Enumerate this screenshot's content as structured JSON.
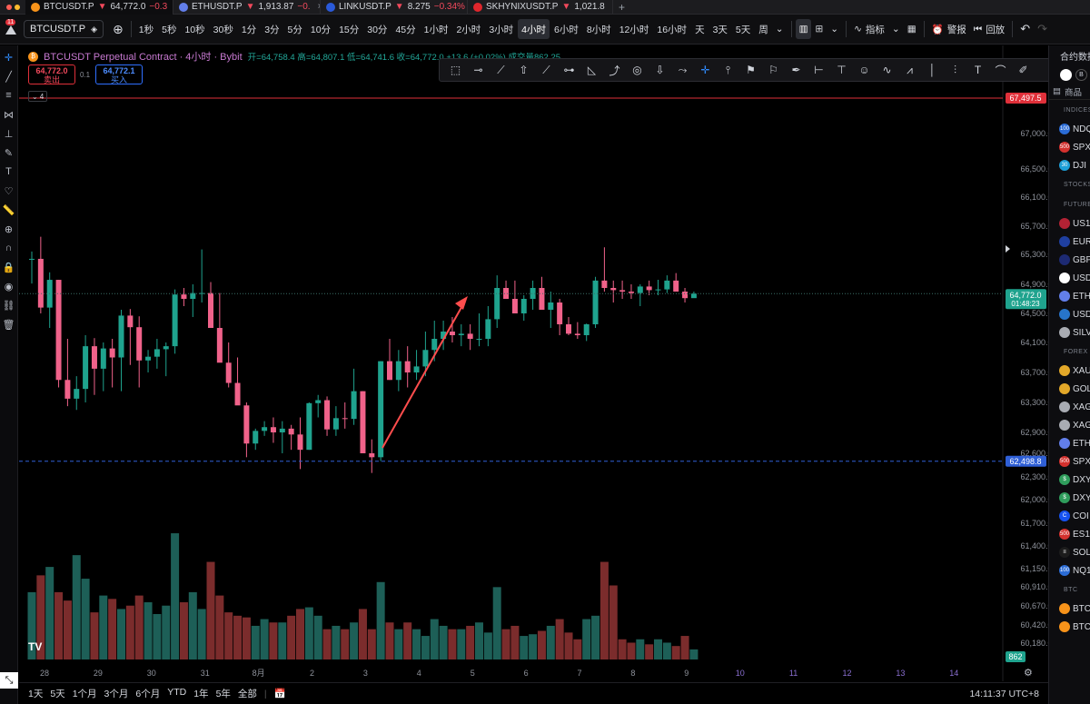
{
  "tabs": [
    {
      "name": "BTCUSDT.P",
      "arrow": "▼",
      "price": "64,772.0",
      "change": "−0.3",
      "icon": "bitcoin-icon",
      "color": "#f7931a",
      "active": true
    },
    {
      "name": "ETHUSDT.P",
      "arrow": "▼",
      "price": "1,913.87",
      "change": "−0.",
      "icon": "ethereum-icon",
      "color": "#627eea",
      "active": false
    },
    {
      "name": "LINKUSDT.P",
      "arrow": "▼",
      "price": "8.275",
      "change": "−0.34%",
      "icon": "chainlink-icon",
      "color": "#2a5ada",
      "active": false
    },
    {
      "name": "SKHYNIXUSDT.P",
      "arrow": "▼",
      "price": "1,021.8",
      "change": "",
      "icon": "skhynix-icon",
      "color": "#e0262c",
      "active": false
    }
  ],
  "toolbar": {
    "notif_count": "11",
    "symbol": "BTCUSDT.P",
    "intervals": [
      "1秒",
      "5秒",
      "10秒",
      "30秒",
      "1分",
      "3分",
      "5分",
      "10分",
      "15分",
      "30分",
      "45分",
      "1小时",
      "2小时",
      "3小时",
      "4小时",
      "6小时",
      "8小时",
      "12小时",
      "16小时",
      "天",
      "3天",
      "5天",
      "周"
    ],
    "active_interval": "4小时",
    "indicators_label": "指标",
    "alert_label": "警报",
    "replay_label": "回放"
  },
  "legend": {
    "title": "BTCUSDT Perpetual Contract · 4小时 · Bybit",
    "ohlc": "开=64,758.4 高=64,807.1 低=64,741.6 收=64,772.0 +13.6 (+0.02%) 成交量862.25",
    "sell_price": "64,772.0",
    "sell_label": "卖出",
    "spread": "0.1",
    "buy_price": "64,772.1",
    "buy_label": "买入",
    "collapse": "4"
  },
  "right_panel": {
    "title": "合约数据",
    "search": "商品",
    "sections": [
      {
        "header": "INDICES",
        "items": [
          {
            "label": "NDQ",
            "icon": "100",
            "color": "#2b6cd6"
          },
          {
            "label": "SPX",
            "icon": "500",
            "color": "#d4312e"
          },
          {
            "label": "DJI",
            "icon": "30",
            "color": "#1d9fd8"
          }
        ]
      },
      {
        "header": "STOCKS",
        "items": []
      },
      {
        "header": "FUTURES",
        "items": [
          {
            "label": "US1",
            "icon": "us-flag-icon",
            "color": "#b22234"
          },
          {
            "label": "EUR",
            "icon": "eu-flag-icon",
            "color": "#1f3fa0"
          },
          {
            "label": "GBP",
            "icon": "gb-flag-icon",
            "color": "#1d2a73"
          },
          {
            "label": "USD",
            "icon": "usdc-icon",
            "color": "#ffffff"
          },
          {
            "label": "ETH",
            "icon": "eth-icon",
            "color": "#627eea"
          },
          {
            "label": "USD",
            "icon": "usdc-icon",
            "color": "#2775ca"
          },
          {
            "label": "SILV",
            "icon": "silver-icon",
            "color": "#a9acb3"
          }
        ]
      },
      {
        "header": "FOREX",
        "items": [
          {
            "label": "XAU",
            "icon": "gold-icon",
            "color": "#e3a829"
          },
          {
            "label": "GOL",
            "icon": "gold-icon",
            "color": "#e3a829"
          },
          {
            "label": "XAG",
            "icon": "silver-icon",
            "color": "#a9acb3"
          },
          {
            "label": "XAG",
            "icon": "silver-icon",
            "color": "#a9acb3"
          },
          {
            "label": "ETH",
            "icon": "eth-icon",
            "color": "#627eea"
          },
          {
            "label": "SPX",
            "icon": "500",
            "color": "#d4312e"
          },
          {
            "label": "DXY",
            "icon": "$",
            "color": "#2f9d5c"
          },
          {
            "label": "DXY",
            "icon": "$",
            "color": "#2f9d5c"
          },
          {
            "label": "COI",
            "icon": "C",
            "color": "#1652f0"
          },
          {
            "label": "ES1",
            "icon": "500",
            "color": "#d4312e"
          },
          {
            "label": "SOL",
            "icon": "≡",
            "color": "#1c1c1c"
          },
          {
            "label": "NQ1",
            "icon": "100",
            "color": "#2b6cd6"
          }
        ]
      },
      {
        "header": "BTC",
        "items": [
          {
            "label": "BTC",
            "icon": "btc-icon",
            "color": "#f7931a"
          },
          {
            "label": "BTC",
            "icon": "btc-icon",
            "color": "#f7931a"
          }
        ]
      }
    ]
  },
  "price_axis": {
    "ticks": [
      "67,000.0",
      "66,500.0",
      "66,100.0",
      "65,700.0",
      "65,300.0",
      "64,900.0",
      "64,500.0",
      "64,100.0",
      "63,700.0",
      "63,300.0",
      "62,900.0",
      "62,600.0",
      "62,300.0",
      "62,000.0",
      "61,700.0",
      "61,400.0",
      "61,150.0",
      "60,910.0",
      "60,670.0",
      "60,420.0",
      "60,180.0"
    ],
    "alert_label": "67,497.5",
    "last_price": "64,772.0",
    "countdown": "01:48:23",
    "support_label": "62,498.8",
    "volume_label": "862"
  },
  "time_axis": {
    "labels": [
      "28",
      "29",
      "30",
      "31",
      "8月",
      "2",
      "3",
      "4",
      "5",
      "6",
      "7",
      "8",
      "9",
      "10",
      "11",
      "12",
      "13",
      "14"
    ]
  },
  "bottom": {
    "ranges": [
      "1天",
      "5天",
      "1个月",
      "3个月",
      "6个月",
      "YTD",
      "1年",
      "5年",
      "全部"
    ],
    "clock": "14:11:37 UTC+8"
  },
  "colors": {
    "up": "#1fa38e",
    "down": "#f0628a",
    "vol_up": "#1d5f57",
    "vol_down": "#7b2c2c",
    "accent": "#2f8cff",
    "alert": "#e0303a"
  },
  "chart_data": {
    "type": "candlestick",
    "title": "BTCUSDT Perpetual Contract · 4小时 · Bybit",
    "x": [
      "7/28",
      "7/29",
      "7/30",
      "7/31",
      "8/1",
      "8/2",
      "8/3",
      "8/4",
      "8/5",
      "8/6",
      "8/7",
      "8/8",
      "8/9",
      "8/10",
      "8/11",
      "8/12",
      "8/13",
      "8/14"
    ],
    "candles": [
      [
        65240,
        65340,
        64910,
        65240
      ],
      [
        65240,
        65550,
        64500,
        64580
      ],
      [
        64580,
        65060,
        64300,
        64960
      ],
      [
        64960,
        64960,
        63500,
        63600
      ],
      [
        63600,
        64150,
        63250,
        63350
      ],
      [
        63350,
        63650,
        63200,
        63480
      ],
      [
        63480,
        64200,
        63300,
        64050
      ],
      [
        64050,
        64160,
        63400,
        63750
      ],
      [
        63750,
        64100,
        63450,
        64020
      ],
      [
        64020,
        64150,
        63500,
        63900
      ],
      [
        63900,
        64550,
        63450,
        64470
      ],
      [
        64470,
        64560,
        63800,
        64310
      ],
      [
        64310,
        64460,
        63500,
        63860
      ],
      [
        63860,
        64000,
        63700,
        63910
      ],
      [
        63910,
        64150,
        63750,
        64010
      ],
      [
        64010,
        64100,
        63650,
        64050
      ],
      [
        64050,
        64830,
        63950,
        64760
      ],
      [
        64760,
        64850,
        64600,
        64700
      ],
      [
        64700,
        64900,
        64450,
        64780
      ],
      [
        64780,
        65370,
        64650,
        64780
      ],
      [
        64780,
        64930,
        64300,
        64300
      ],
      [
        64300,
        64780,
        63850,
        63830
      ],
      [
        63830,
        64100,
        63500,
        63560
      ],
      [
        63560,
        63900,
        63350,
        63260
      ],
      [
        63260,
        63300,
        62550,
        62740
      ],
      [
        62740,
        62950,
        62650,
        62920
      ],
      [
        62920,
        63050,
        62850,
        62970
      ],
      [
        62970,
        63100,
        62750,
        62900
      ],
      [
        62900,
        63050,
        62600,
        62950
      ],
      [
        62950,
        63000,
        62650,
        62870
      ],
      [
        62870,
        63100,
        62400,
        62650
      ],
      [
        62650,
        63300,
        62650,
        63290
      ],
      [
        63290,
        63400,
        63100,
        63330
      ],
      [
        63330,
        63380,
        62850,
        62940
      ],
      [
        62940,
        63250,
        62850,
        63090
      ],
      [
        63090,
        63300,
        62950,
        63080
      ],
      [
        63080,
        63750,
        63000,
        63450
      ],
      [
        63450,
        63450,
        62700,
        62600
      ],
      [
        62600,
        62800,
        62350,
        62550
      ],
      [
        62550,
        63850,
        62500,
        63850
      ],
      [
        63850,
        64150,
        63600,
        63600
      ],
      [
        63600,
        64000,
        63450,
        63850
      ],
      [
        63850,
        64050,
        63500,
        63700
      ],
      [
        63700,
        64000,
        63600,
        63780
      ],
      [
        63780,
        64250,
        63650,
        64000
      ],
      [
        64000,
        64400,
        63850,
        64150
      ],
      [
        64150,
        64400,
        64000,
        64250
      ],
      [
        64250,
        64450,
        64100,
        64200
      ],
      [
        64200,
        64350,
        64050,
        64220
      ],
      [
        64220,
        64350,
        64000,
        64150
      ],
      [
        64150,
        64500,
        64050,
        64150
      ],
      [
        64150,
        64600,
        64050,
        64420
      ],
      [
        64420,
        65020,
        64300,
        64850
      ],
      [
        64850,
        64950,
        64700,
        64700
      ],
      [
        64700,
        64950,
        64550,
        64500
      ],
      [
        64500,
        64750,
        64400,
        64700
      ],
      [
        64700,
        64950,
        64550,
        64850
      ],
      [
        64850,
        65000,
        64600,
        64550
      ],
      [
        64550,
        64800,
        64300,
        64650
      ],
      [
        64650,
        64700,
        64200,
        64350
      ],
      [
        64350,
        64450,
        64200,
        64220
      ],
      [
        64220,
        64380,
        64150,
        64200
      ],
      [
        64200,
        64360,
        64120,
        64350
      ],
      [
        64350,
        65000,
        64300,
        64950
      ],
      [
        64950,
        65400,
        64800,
        64850
      ],
      [
        64850,
        64950,
        64650,
        64820
      ],
      [
        64820,
        64950,
        64700,
        64800
      ],
      [
        64800,
        64900,
        64700,
        64780
      ],
      [
        64780,
        64900,
        64600,
        64870
      ],
      [
        64870,
        64950,
        64750,
        64820
      ],
      [
        64820,
        64960,
        64750,
        64830
      ],
      [
        64830,
        65020,
        64780,
        64950
      ],
      [
        64950,
        65050,
        64800,
        64800
      ],
      [
        64800,
        64850,
        64650,
        64710
      ],
      [
        64710,
        64800,
        64741,
        64772
      ]
    ],
    "volumes": [
      40,
      50,
      55,
      40,
      35,
      62,
      48,
      28,
      38,
      36,
      30,
      32,
      38,
      34,
      27,
      32,
      75,
      34,
      40,
      30,
      58,
      38,
      28,
      26,
      25,
      20,
      24,
      22,
      22,
      26,
      30,
      31,
      26,
      18,
      20,
      18,
      22,
      30,
      18,
      46,
      22,
      18,
      22,
      18,
      14,
      24,
      20,
      18,
      18,
      20,
      22,
      16,
      43,
      18,
      20,
      14,
      15,
      17,
      20,
      24,
      16,
      12,
      24,
      26,
      58,
      44,
      12,
      10,
      12,
      9,
      12,
      10,
      8,
      14,
      6
    ],
    "ylim": [
      60000,
      67600
    ],
    "alert_line": 67497.5,
    "support_line": 62498.8,
    "last_price": 64772.0
  }
}
